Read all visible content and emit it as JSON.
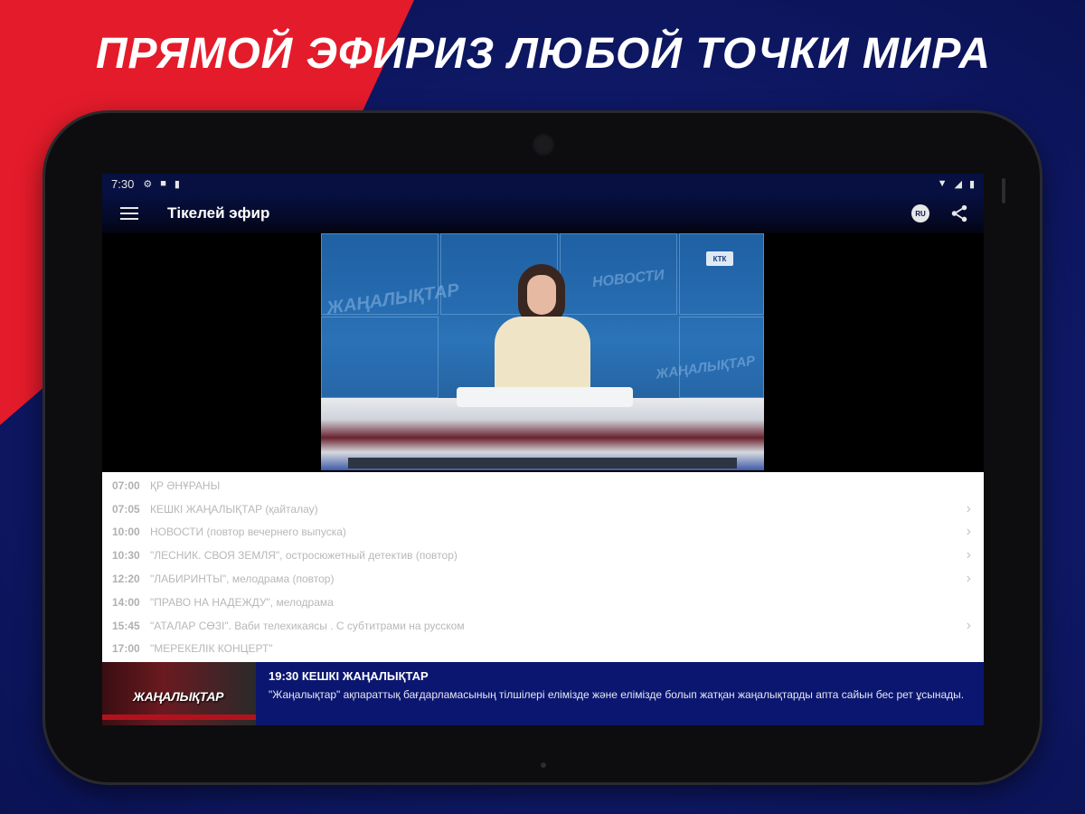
{
  "promo": {
    "headline_left": "ПРЯМОЙ ЭФИР",
    "headline_right": "ИЗ ЛЮБОЙ ТОЧКИ МИРА",
    "accent_red": "#e41b2a",
    "background_blue": "#0f1a6a"
  },
  "statusbar": {
    "time": "7:30",
    "left_icons": [
      "gear-icon",
      "notification-icon",
      "sd-card-icon"
    ],
    "right_icons": [
      "wifi-icon",
      "signal-icon",
      "battery-icon"
    ]
  },
  "appbar": {
    "title": "Тікелей эфир",
    "language_badge": "RU"
  },
  "video": {
    "channel_logo": "КТК",
    "wall_text_1": "ЖАҢАЛЫҚТАР",
    "wall_text_2": "НОВОСТИ",
    "lower_third_left": "",
    "lower_third_right": ""
  },
  "schedule": [
    {
      "time": "07:00",
      "title": "ҚР ӘНҰРАНЫ",
      "has_chevron": false
    },
    {
      "time": "07:05",
      "title": "КЕШКІ ЖАҢАЛЫҚТАР (қайталау)",
      "has_chevron": true
    },
    {
      "time": "10:00",
      "title": "НОВОСТИ (повтор вечернего выпуска)",
      "has_chevron": true
    },
    {
      "time": "10:30",
      "title": "\"ЛЕСНИК. СВОЯ ЗЕМЛЯ\", остросюжетный детектив (повтор)",
      "has_chevron": true
    },
    {
      "time": "12:20",
      "title": "\"ЛАБИРИНТЫ\", мелодрама (повтор)",
      "has_chevron": true
    },
    {
      "time": "14:00",
      "title": "\"ПРАВО НА НАДЕЖДУ\", мелодрама",
      "has_chevron": false
    },
    {
      "time": "15:45",
      "title": "\"АТАЛАР СӨЗІ\". Ваби телехикаясы . С субтитрами на русском",
      "has_chevron": true
    },
    {
      "time": "17:00",
      "title": "\"МЕРЕКЕЛІК КОНЦЕРТ\"",
      "has_chevron": false
    }
  ],
  "now_playing": {
    "thumbnail_text": "ЖАҢАЛЫҚТАР",
    "title": "19:30 КЕШКІ ЖАҢАЛЫҚТАР",
    "description": "\"Жаңалықтар\" ақпараттық бағдарламасының тілшілері елімізде және елімізде болып жатқан жаңалықтарды апта сайын бес рет ұсынады."
  }
}
